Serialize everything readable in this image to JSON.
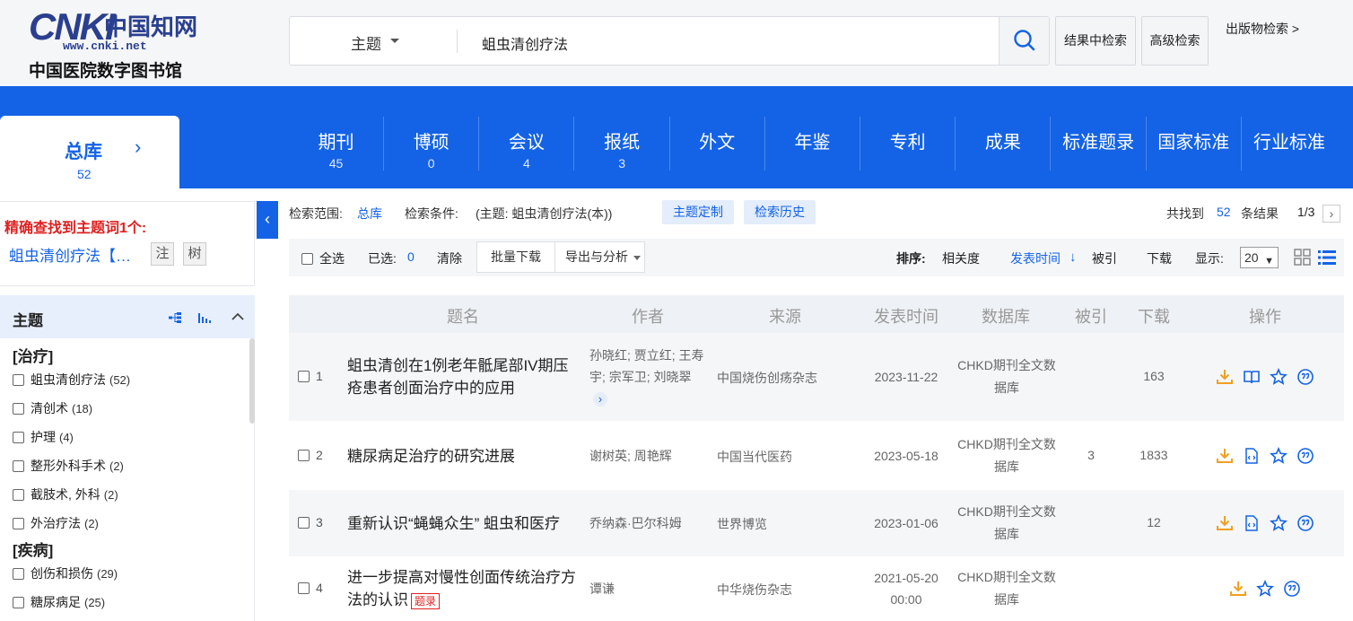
{
  "header": {
    "logo_brand": "CNKI",
    "logo_cn": "中国知网",
    "logo_url": "www.cnki.net",
    "logo_sub": "中国医院数字图书馆",
    "search_field": "主题",
    "search_query": "蛆虫清创疗法",
    "btn_within": "结果中检索",
    "btn_advanced": "高级检索",
    "publication_search": "出版物检索 >"
  },
  "nav": {
    "all": {
      "label": "总库",
      "count": "52"
    },
    "tabs": [
      {
        "label": "期刊",
        "count": "45"
      },
      {
        "label": "博硕",
        "count": "0"
      },
      {
        "label": "会议",
        "count": "4"
      },
      {
        "label": "报纸",
        "count": "3"
      },
      {
        "label": "外文",
        "count": ""
      },
      {
        "label": "年鉴",
        "count": ""
      },
      {
        "label": "专利",
        "count": ""
      },
      {
        "label": "成果",
        "count": ""
      },
      {
        "label": "标准题录",
        "count": ""
      },
      {
        "label": "国家标准",
        "count": ""
      },
      {
        "label": "行业标准",
        "count": ""
      }
    ]
  },
  "exact": {
    "heading": "精确查找到主题词1个:",
    "term": "蛆虫清创疗法【蛆虫清创疗法】",
    "btn_note": "注",
    "btn_tree": "树"
  },
  "facet": {
    "title": "主题",
    "groups": [
      {
        "name": "[治疗]",
        "items": [
          {
            "label": "蛆虫清创疗法",
            "count": "(52)"
          },
          {
            "label": "清创术",
            "count": "(18)"
          },
          {
            "label": "护理",
            "count": "(4)"
          },
          {
            "label": "整形外科手术",
            "count": "(2)"
          },
          {
            "label": "截肢术, 外科",
            "count": "(2)"
          },
          {
            "label": "外治疗法",
            "count": "(2)"
          }
        ]
      },
      {
        "name": "[疾病]",
        "items": [
          {
            "label": "创伤和损伤",
            "count": "(29)"
          },
          {
            "label": "糖尿病足",
            "count": "(25)"
          }
        ]
      }
    ]
  },
  "criteria": {
    "scope_label": "检索范围:",
    "scope_value": "总库",
    "cond_label": "检索条件:",
    "cond_value": "(主题: 蛆虫清创疗法(本))",
    "btn_custom": "主题定制",
    "btn_history": "检索历史",
    "found_pre": "共找到",
    "found_count": "52",
    "found_post": "条结果",
    "page": "1/3"
  },
  "toolbar": {
    "select_all": "全选",
    "selected_label": "已选:",
    "selected_count": "0",
    "clear": "清除",
    "batch_download": "批量下载",
    "export": "导出与分析",
    "sort_label": "排序:",
    "sort_relevance": "相关度",
    "sort_date": "发表时间",
    "sort_cited": "被引",
    "sort_download": "下载",
    "display_label": "显示:",
    "display_value": "20"
  },
  "table": {
    "headers": {
      "title": "题名",
      "author": "作者",
      "source": "来源",
      "date": "发表时间",
      "db": "数据库",
      "cited": "被引",
      "downloads": "下载",
      "ops": "操作"
    },
    "rows": [
      {
        "idx": "1",
        "title": "蛆虫清创在1例老年骶尾部IV期压疮患者创面治疗中的应用",
        "author": "孙晓红; 贾立红; 王寿宇; 宗军卫; 刘晓翠",
        "source": "中国烧伤创疡杂志",
        "date": "2023-11-22",
        "db": "CHKD期刊全文数据库",
        "cited": "",
        "downloads": "163"
      },
      {
        "idx": "2",
        "title": "糖尿病足治疗的研究进展",
        "author": "谢树英; 周艳辉",
        "source": "中国当代医药",
        "date": "2023-05-18",
        "db": "CHKD期刊全文数据库",
        "cited": "3",
        "downloads": "1833"
      },
      {
        "idx": "3",
        "title": "重新认识“蝇蝇众生” 蛆虫和医疗",
        "author": "乔纳森·巴尔科姆",
        "source": "世界博览",
        "date": "2023-01-06",
        "db": "CHKD期刊全文数据库",
        "cited": "",
        "downloads": "12"
      },
      {
        "idx": "4",
        "title": "进一步提高对慢性创面传统治疗方法的认识",
        "tag": "题录",
        "author": "谭谦",
        "source": "中华烧伤杂志",
        "date": "2021-05-20 00:00",
        "db": "CHKD期刊全文数据库",
        "cited": "",
        "downloads": ""
      }
    ]
  },
  "colors": {
    "brand_blue": "#1463e6",
    "red": "#e02020",
    "icon_orange": "#f0a020"
  }
}
